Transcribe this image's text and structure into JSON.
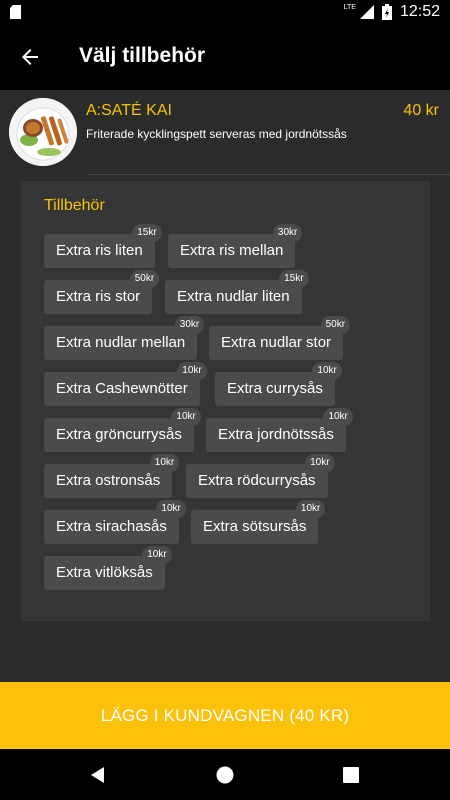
{
  "status_bar": {
    "time": "12:52",
    "network": "LTE"
  },
  "app_bar": {
    "title": "Välj tillbehör"
  },
  "product": {
    "name": "A:SATÉ KAI",
    "price": "40 kr",
    "description": "Friterade kycklingspett serveras med jordnötssås"
  },
  "options": {
    "title": "Tillbehör",
    "items": [
      {
        "label": "Extra ris liten",
        "price": "15kr"
      },
      {
        "label": "Extra ris mellan",
        "price": "30kr"
      },
      {
        "label": "Extra ris stor",
        "price": "50kr"
      },
      {
        "label": "Extra nudlar liten",
        "price": "15kr"
      },
      {
        "label": "Extra nudlar mellan",
        "price": "30kr"
      },
      {
        "label": "Extra nudlar stor",
        "price": "50kr"
      },
      {
        "label": "Extra Cashewnötter",
        "price": "10kr"
      },
      {
        "label": "Extra currysås",
        "price": "10kr"
      },
      {
        "label": "Extra gröncurrysås",
        "price": "10kr"
      },
      {
        "label": "Extra jordnötssås",
        "price": "10kr"
      },
      {
        "label": "Extra ostronsås",
        "price": "10kr"
      },
      {
        "label": "Extra rödcurrysås",
        "price": "10kr"
      },
      {
        "label": "Extra sirachasås",
        "price": "10kr"
      },
      {
        "label": "Extra sötsursås",
        "price": "10kr"
      },
      {
        "label": "Extra vitlöksås",
        "price": "10kr"
      }
    ]
  },
  "cart_button": {
    "label": "LÄGG I KUNDVAGNEN (40 KR)"
  },
  "colors": {
    "accent": "#f5c400",
    "button": "#fcc10b",
    "background": "#2b2b2b",
    "chip": "#4b4b4b"
  },
  "icons": {
    "back": "arrow-back-icon",
    "nav_back": "triangle-back-icon",
    "nav_home": "circle-home-icon",
    "nav_recents": "square-recents-icon"
  }
}
